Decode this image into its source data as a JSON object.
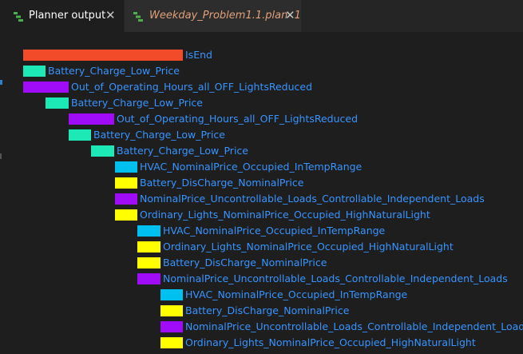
{
  "tabs": [
    {
      "label": "Planner output",
      "icon": "plan-icon",
      "close": "✕",
      "active": true
    },
    {
      "label": "Weekday_Problem1.1.plan",
      "badge": "1",
      "icon": "plan-icon",
      "close": "✕",
      "active": false,
      "label_color": "#e2a07a"
    }
  ],
  "colors": {
    "goal": "#f24b2a",
    "battery_charge": "#1de9b6",
    "lights_reduced": "#a10cf8",
    "hvac": "#00c0f0",
    "discharge": "#ffff00",
    "uncontrollable": "#a10cf8",
    "ordinary_lights": "#ffff00",
    "label": "#3794ff"
  },
  "plan": {
    "steps": [
      {
        "name": "IsEnd",
        "color": "#f24b2a"
      },
      {
        "name": "Battery_Charge_Low_Price",
        "color": "#1de9b6"
      },
      {
        "name": "Out_of_Operating_Hours_all_OFF_LightsReduced",
        "color": "#a10cf8"
      },
      {
        "name": "Battery_Charge_Low_Price",
        "color": "#1de9b6"
      },
      {
        "name": "Out_of_Operating_Hours_all_OFF_LightsReduced",
        "color": "#a10cf8"
      },
      {
        "name": "Battery_Charge_Low_Price",
        "color": "#1de9b6"
      },
      {
        "name": "Battery_Charge_Low_Price",
        "color": "#1de9b6"
      },
      {
        "name": "HVAC_NominalPrice_Occupied_InTempRange",
        "color": "#00c0f0"
      },
      {
        "name": "Battery_DisCharge_NominalPrice",
        "color": "#ffff00"
      },
      {
        "name": "NominalPrice_Uncontrollable_Loads_Controllable_Independent_Loads",
        "color": "#a10cf8"
      },
      {
        "name": "Ordinary_Lights_NominalPrice_Occupied_HighNaturalLight",
        "color": "#ffff00"
      },
      {
        "name": "HVAC_NominalPrice_Occupied_InTempRange",
        "color": "#00c0f0"
      },
      {
        "name": "Ordinary_Lights_NominalPrice_Occupied_HighNaturalLight",
        "color": "#ffff00"
      },
      {
        "name": "Battery_DisCharge_NominalPrice",
        "color": "#ffff00"
      },
      {
        "name": "NominalPrice_Uncontrollable_Loads_Controllable_Independent_Loads",
        "color": "#a10cf8"
      },
      {
        "name": "HVAC_NominalPrice_Occupied_InTempRange",
        "color": "#00c0f0"
      },
      {
        "name": "Battery_DisCharge_NominalPrice",
        "color": "#ffff00"
      },
      {
        "name": "NominalPrice_Uncontrollable_Loads_Controllable_Independent_Loads",
        "color": "#a10cf8"
      },
      {
        "name": "Ordinary_Lights_NominalPrice_Occupied_HighNaturalLight",
        "color": "#ffff00"
      }
    ]
  }
}
